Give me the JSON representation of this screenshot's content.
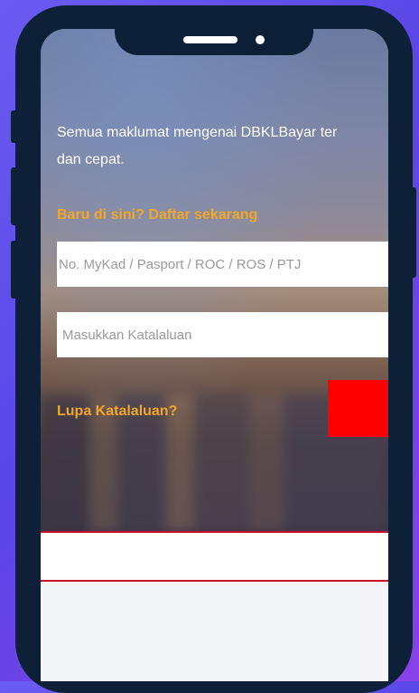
{
  "hero": {
    "description_line1": "Semua maklumat mengenai DBKLBayar ter",
    "description_line2": "dan cepat."
  },
  "register_link": "Baru di sini? Daftar sekarang",
  "login_form": {
    "id_placeholder": "No. MyKad / Pasport / ROC / ROS / PTJ",
    "password_placeholder": "Masukkan Katalaluan",
    "forgot_password": "Lupa Katalaluan?",
    "login_button_label": ""
  },
  "colors": {
    "accent_orange": "#f2a62a",
    "button_red": "#ff0000",
    "frame_navy": "#0d2038",
    "divider_red": "#c8102e"
  }
}
